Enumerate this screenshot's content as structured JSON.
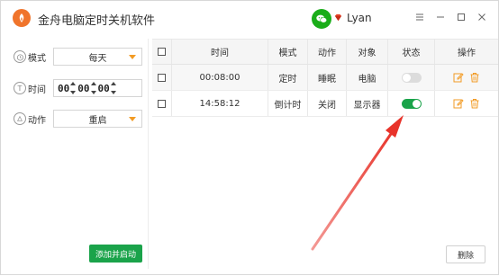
{
  "app": {
    "title": "金舟电脑定时关机软件",
    "username": "Lyan"
  },
  "window_controls": [
    "☰",
    "—",
    "☐",
    "✕"
  ],
  "left_panel": {
    "mode_label": "模式",
    "mode_value": "每天",
    "time_label": "时间",
    "time_value": {
      "hh": "00",
      "mm": "00",
      "ss": "00"
    },
    "action_label": "动作",
    "action_value": "重启",
    "add_button": "添加并启动"
  },
  "table": {
    "headers": [
      "时间",
      "模式",
      "动作",
      "对象",
      "状态",
      "操作"
    ],
    "rows": [
      {
        "time": "00:08:00",
        "mode": "定时",
        "action": "睡眠",
        "target": "电脑",
        "enabled": false
      },
      {
        "time": "14:58:12",
        "mode": "倒计时",
        "action": "关闭",
        "target": "显示器",
        "enabled": true
      }
    ]
  },
  "delete_button": "删除",
  "colors": {
    "accent_green": "#1aa34a",
    "accent_orange": "#f29b24",
    "annotation_arrow": "#e8332a"
  }
}
